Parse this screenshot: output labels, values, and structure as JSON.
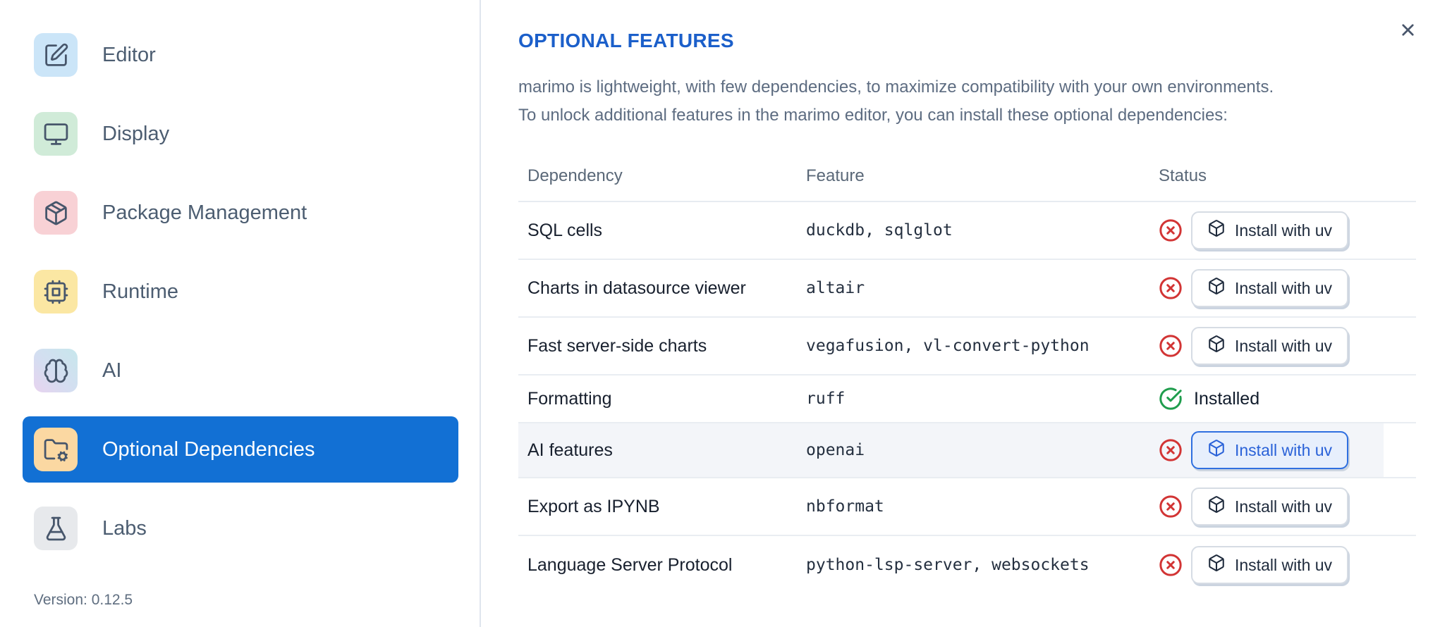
{
  "sidebar": {
    "items": [
      {
        "id": "editor",
        "label": "Editor",
        "icon": "square-pen",
        "tile_bg": "#cbe5f8",
        "selected": false
      },
      {
        "id": "display",
        "label": "Display",
        "icon": "monitor",
        "tile_bg": "#d0ebd8",
        "selected": false
      },
      {
        "id": "package-management",
        "label": "Package Management",
        "icon": "package",
        "tile_bg": "#f8d1d5",
        "selected": false
      },
      {
        "id": "runtime",
        "label": "Runtime",
        "icon": "cpu",
        "tile_bg": "#fbe7a3",
        "selected": false
      },
      {
        "id": "ai",
        "label": "AI",
        "icon": "brain",
        "tile_bg": "linear-gradient(225deg, #c7e7ec 0%, #d4def1 55%, #e8d3ef 100%)",
        "selected": false
      },
      {
        "id": "optional-dependencies",
        "label": "Optional Dependencies",
        "icon": "folder-cog",
        "tile_bg": "#fbd8a2",
        "selected": true
      },
      {
        "id": "labs",
        "label": "Labs",
        "icon": "flask",
        "tile_bg": "#e7e9ec",
        "selected": false
      }
    ],
    "version_label": "Version: 0.12.5"
  },
  "panel": {
    "title": "OPTIONAL FEATURES",
    "description_lines": [
      "marimo is lightweight, with few dependencies, to maximize compatibility with your own environments.",
      "To unlock additional features in the marimo editor, you can install these optional dependencies:"
    ],
    "close_icon": "x-icon",
    "table": {
      "columns": [
        "Dependency",
        "Feature",
        "Status"
      ],
      "rows": [
        {
          "dependency": "SQL cells",
          "feature": "duckdb, sqlglot",
          "status": "not-installed",
          "action_label": "Install with uv",
          "highlighted": false
        },
        {
          "dependency": "Charts in datasource viewer",
          "feature": "altair",
          "status": "not-installed",
          "action_label": "Install with uv",
          "highlighted": false
        },
        {
          "dependency": "Fast server-side charts",
          "feature": "vegafusion, vl-convert-python",
          "status": "not-installed",
          "action_label": "Install with uv",
          "highlighted": false
        },
        {
          "dependency": "Formatting",
          "feature": "ruff",
          "status": "installed",
          "status_label": "Installed",
          "highlighted": false
        },
        {
          "dependency": "AI features",
          "feature": "openai",
          "status": "not-installed",
          "action_label": "Install with uv",
          "highlighted": true
        },
        {
          "dependency": "Export as IPYNB",
          "feature": "nbformat",
          "status": "not-installed",
          "action_label": "Install with uv",
          "highlighted": false
        },
        {
          "dependency": "Language Server Protocol",
          "feature": "python-lsp-server, websockets",
          "status": "not-installed",
          "action_label": "Install with uv",
          "highlighted": false
        }
      ]
    }
  },
  "colors": {
    "accent_blue": "#1270d4",
    "title_blue": "#1b5fca",
    "focused_button_blue": "#2e6fe0",
    "error_red": "#d23434",
    "success_green": "#1f9d4d"
  }
}
